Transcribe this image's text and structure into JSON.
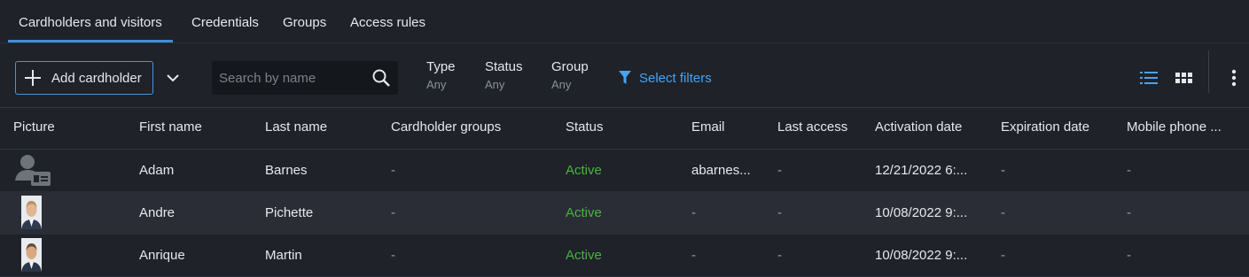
{
  "tabs": [
    {
      "label": "Cardholders and visitors",
      "active": true
    },
    {
      "label": "Credentials"
    },
    {
      "label": "Groups"
    },
    {
      "label": "Access rules"
    }
  ],
  "toolbar": {
    "add_label": "Add cardholder",
    "search_placeholder": "Search by name",
    "filters": [
      {
        "title": "Type",
        "value": "Any"
      },
      {
        "title": "Status",
        "value": "Any"
      },
      {
        "title": "Group",
        "value": "Any"
      }
    ],
    "select_filters_label": "Select filters",
    "accent": "#3f90d9"
  },
  "table": {
    "columns": [
      "Picture",
      "First name",
      "Last name",
      "Cardholder groups",
      "Status",
      "Email",
      "Last access",
      "Activation date",
      "Expiration date",
      "Mobile phone ..."
    ],
    "rows": [
      {
        "picture": "placeholder-avatar",
        "first": "Adam",
        "last": "Barnes",
        "groups": "-",
        "status": "Active",
        "email": "abarnes...",
        "last_access": "-",
        "activation": "12/21/2022 6:...",
        "expiration": "-",
        "mobile": "-"
      },
      {
        "picture": "photo",
        "first": "Andre",
        "last": "Pichette",
        "groups": "-",
        "status": "Active",
        "email": "-",
        "last_access": "-",
        "activation": "10/08/2022 9:...",
        "expiration": "-",
        "mobile": "-"
      },
      {
        "picture": "photo",
        "first": "Anrique",
        "last": "Martin",
        "groups": "-",
        "status": "Active",
        "email": "-",
        "last_access": "-",
        "activation": "10/08/2022 9:...",
        "expiration": "-",
        "mobile": "-"
      }
    ],
    "status_color": "#49b43d"
  }
}
